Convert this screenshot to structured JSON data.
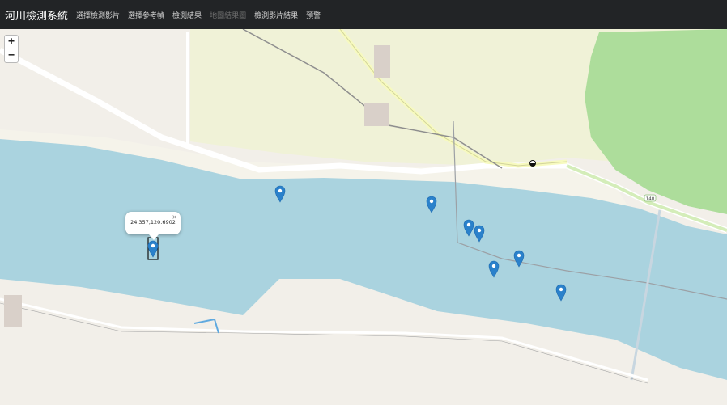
{
  "navbar": {
    "brand": "河川檢測系統",
    "items": [
      {
        "label": "選擇檢測影片",
        "disabled": false
      },
      {
        "label": "選擇參考幀",
        "disabled": false
      },
      {
        "label": "檢測結果",
        "disabled": false
      },
      {
        "label": "地圖結果圖",
        "disabled": true
      },
      {
        "label": "檢測影片結果",
        "disabled": false
      },
      {
        "label": "預警",
        "disabled": false
      }
    ]
  },
  "map": {
    "zoom_in_label": "+",
    "zoom_out_label": "−",
    "popup_text": "24.357,120.6902",
    "popup_close": "×",
    "road_number": "140",
    "colors": {
      "water": "#aad3df",
      "land": "#f2efe9",
      "urban": "#f0f2d7",
      "forest": "#addd9b",
      "marker": "#2a81cb"
    }
  }
}
